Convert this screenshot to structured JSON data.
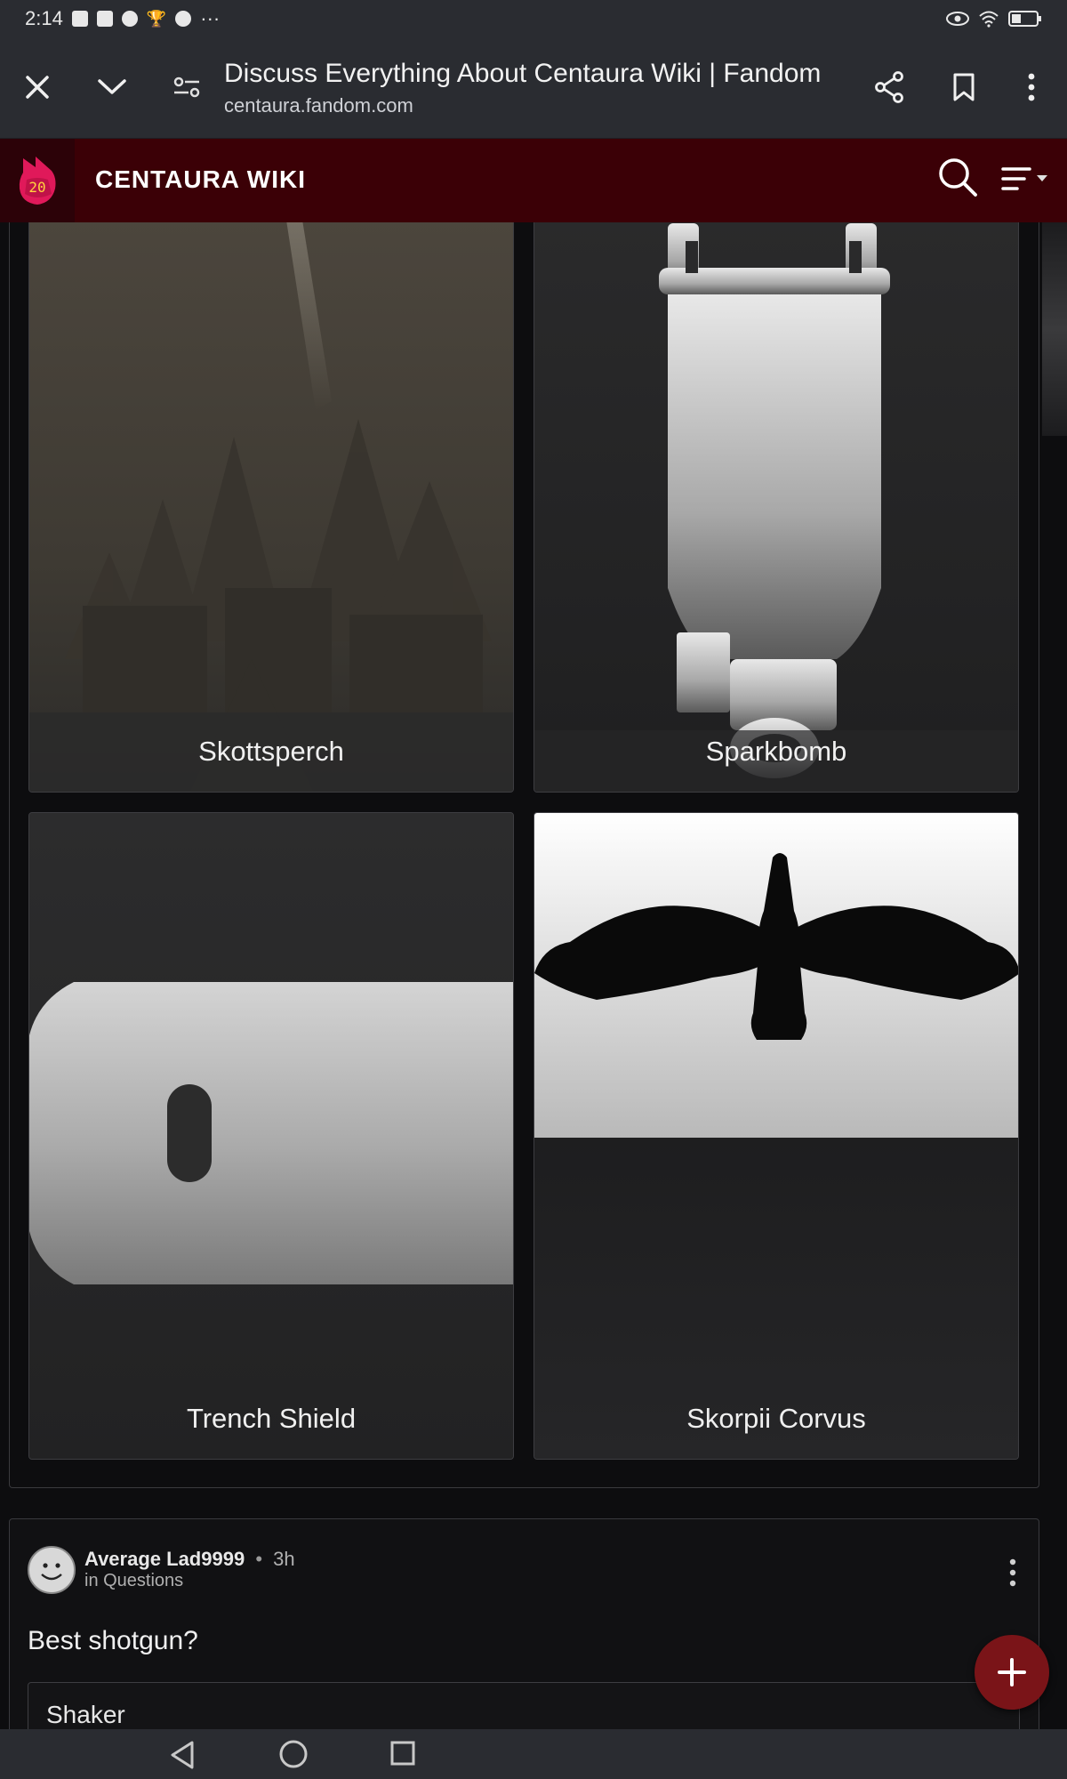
{
  "status_bar": {
    "time": "2:14",
    "overflow": "···",
    "notification_icons": [
      "facebook-icon",
      "facebook-icon",
      "chrome-icon",
      "trophy-icon",
      "chrome-icon"
    ],
    "system_icons": [
      "eye-icon",
      "wifi-icon",
      "battery-icon"
    ]
  },
  "browser": {
    "title": "Discuss Everything About Centaura Wiki | Fandom",
    "url": "centaura.fandom.com"
  },
  "wiki": {
    "name": "CENTAURA WIKI",
    "logo_badge": "20"
  },
  "cards": [
    {
      "label": "Skottsperch"
    },
    {
      "label": "Sparkbomb"
    },
    {
      "label": "Trench Shield"
    },
    {
      "label": "Skorpii Corvus"
    }
  ],
  "post": {
    "author": "Average Lad9999",
    "separator": "•",
    "time": "3h",
    "category": "in Questions",
    "title": "Best shotgun?",
    "option_1": "Shaker"
  },
  "fab": {
    "icon": "plus-icon"
  },
  "colors": {
    "wiki_header": "#3b0006",
    "fab": "#7a1418",
    "background": "#0d0d0f"
  }
}
